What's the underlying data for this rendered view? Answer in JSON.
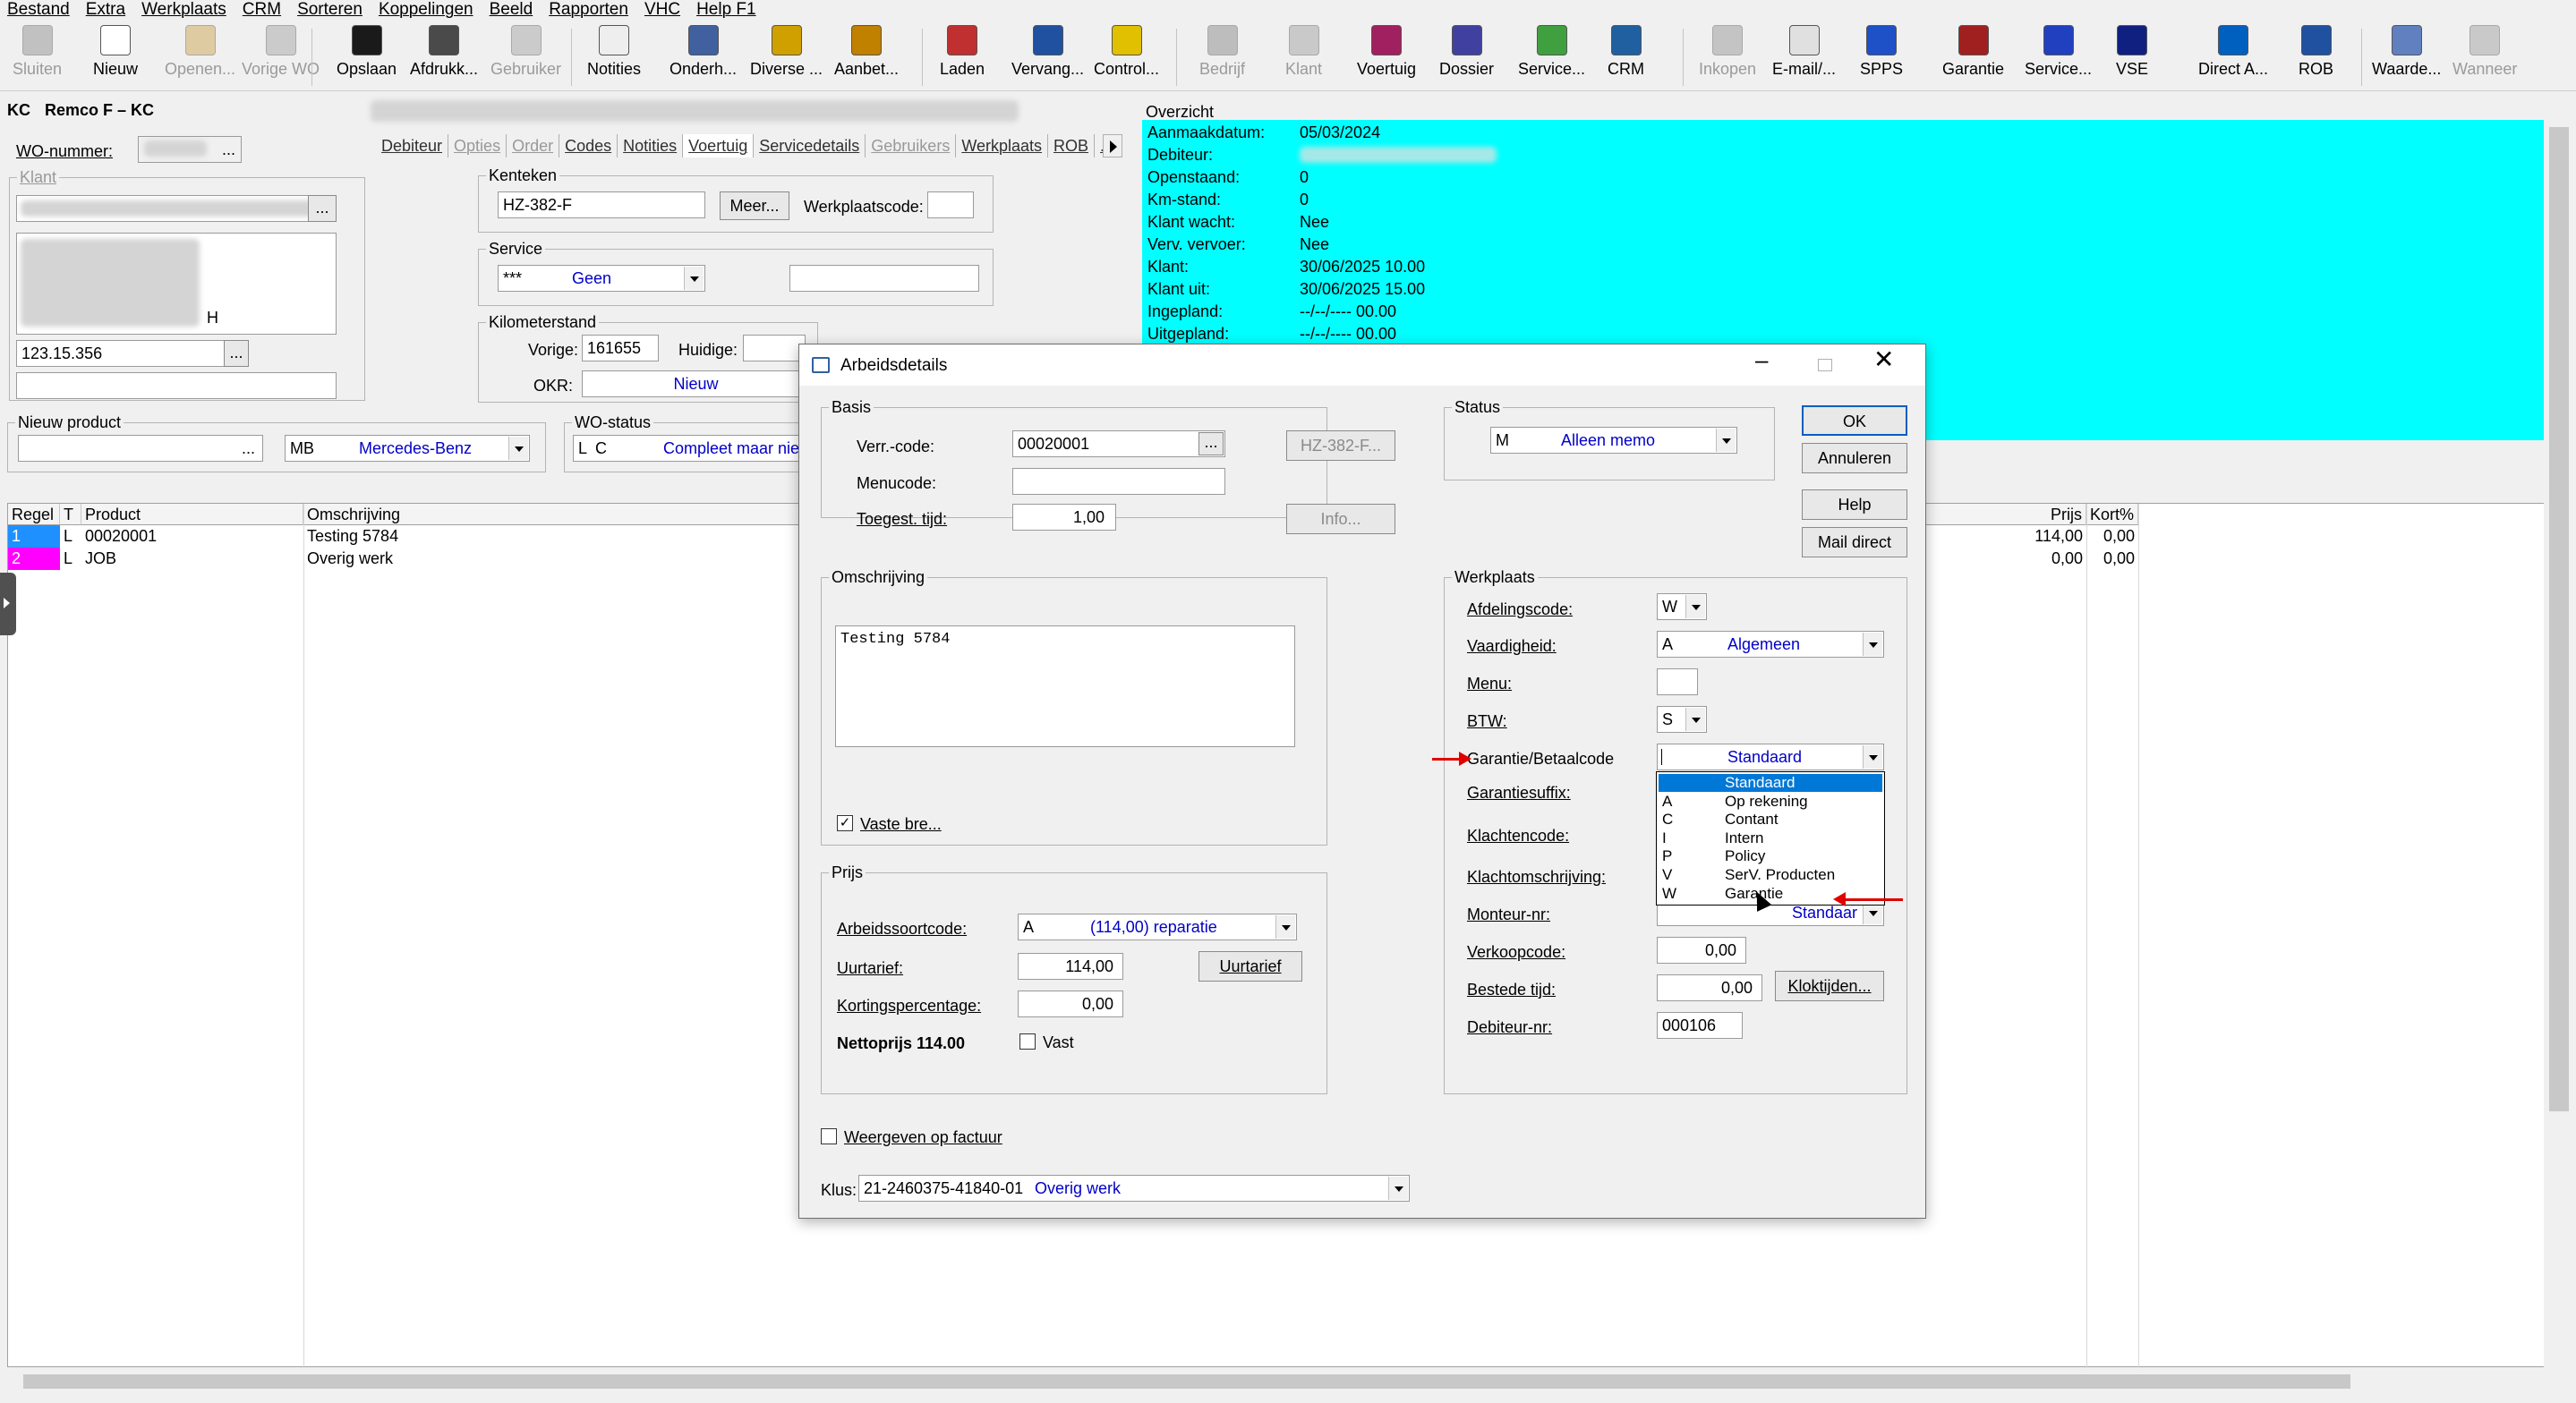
{
  "menu": [
    "Bestand",
    "Extra",
    "Werkplaats",
    "CRM",
    "Sorteren",
    "Koppelingen",
    "Beeld",
    "Rapporten",
    "VHC",
    "Help F1"
  ],
  "toolbar": [
    {
      "label": "Sluiten",
      "icon": "close-door-icon",
      "enabled": false
    },
    {
      "label": "Nieuw",
      "icon": "new-document-icon",
      "enabled": true
    },
    {
      "label": "Openen...",
      "icon": "open-folder-icon",
      "enabled": false
    },
    {
      "label": "Vorige WO",
      "icon": "redo-icon",
      "enabled": false
    },
    {
      "label": "Opslaan",
      "icon": "save-icon",
      "enabled": true
    },
    {
      "label": "Afdrukk...",
      "icon": "printer-icon",
      "enabled": true
    },
    {
      "label": "Gebruiker",
      "icon": "user-icon",
      "enabled": false
    },
    {
      "label": "Notities",
      "icon": "notes-icon",
      "enabled": true
    },
    {
      "label": "Onderh...",
      "icon": "maintenance-icon",
      "enabled": true
    },
    {
      "label": "Diverse ...",
      "icon": "tag-icon",
      "enabled": true
    },
    {
      "label": "Aanbet...",
      "icon": "quote-icon",
      "enabled": true
    },
    {
      "label": "Laden",
      "icon": "load-icon",
      "enabled": true
    },
    {
      "label": "Vervang...",
      "icon": "replace-icon",
      "enabled": true
    },
    {
      "label": "Control...",
      "icon": "keys-icon",
      "enabled": true
    },
    {
      "label": "Bedrijf",
      "icon": "building-icon",
      "enabled": false
    },
    {
      "label": "Klant",
      "icon": "customer-icon",
      "enabled": false
    },
    {
      "label": "Voertuig",
      "icon": "vehicle-icon",
      "enabled": true
    },
    {
      "label": "Dossier",
      "icon": "dossier-icon",
      "enabled": true
    },
    {
      "label": "Service...",
      "icon": "service-icon",
      "enabled": true
    },
    {
      "label": "CRM",
      "icon": "crm-book-icon",
      "enabled": true
    },
    {
      "label": "Inkopen",
      "icon": "purchase-icon",
      "enabled": false
    },
    {
      "label": "E-mail/...",
      "icon": "email-icon",
      "enabled": true
    },
    {
      "label": "SPPS",
      "icon": "spps-icon",
      "enabled": true
    },
    {
      "label": "Garantie",
      "icon": "warranty-icon",
      "enabled": true
    },
    {
      "label": "Service...",
      "icon": "kdm-service-icon",
      "enabled": true
    },
    {
      "label": "VSE",
      "icon": "vse-icon",
      "enabled": true
    },
    {
      "label": "Direct A...",
      "icon": "direct-icon",
      "enabled": true
    },
    {
      "label": "ROB",
      "icon": "rob-icon",
      "enabled": true
    },
    {
      "label": "Waarde...",
      "icon": "value-icon",
      "enabled": true
    },
    {
      "label": "Wanneer",
      "icon": "calendar-icon",
      "enabled": false
    }
  ],
  "header": {
    "kc": "KC",
    "user": "Remco F – KC"
  },
  "wo": {
    "label": "WO-nummer:",
    "klant_label": "Klant",
    "id_value": "123.15.356",
    "h": "H"
  },
  "tabs": [
    "Debiteur",
    "Opties",
    "Order",
    "Codes",
    "Notities",
    "Voertuig",
    "Servicedetails",
    "Gebruikers",
    "Werkplaats",
    "ROB",
    "..."
  ],
  "kenteken": {
    "label": "Kenteken",
    "value": "HZ-382-F",
    "meer": "Meer...",
    "werkplaats_label": "Werkplaatscode:"
  },
  "service": {
    "label": "Service",
    "code": "***",
    "value": "Geen"
  },
  "km": {
    "label": "Kilometerstand",
    "vorige_label": "Vorige:",
    "vorige": "161655",
    "huidige_label": "Huidige:",
    "okr_label": "OKR:",
    "okr": "Nieuw"
  },
  "nieuw_product": {
    "label": "Nieuw product",
    "brand_code": "MB",
    "brand": "Mercedes-Benz"
  },
  "wo_status": {
    "label": "WO-status",
    "code": "L",
    "value": "C",
    "text": "Compleet maar niet g"
  },
  "overzicht": {
    "title": "Overzicht",
    "rows": [
      {
        "k": "Aanmaakdatum:",
        "v": "05/03/2024"
      },
      {
        "k": "Debiteur:",
        "v": ""
      },
      {
        "k": "Openstaand:",
        "v": "0"
      },
      {
        "k": "Km-stand:",
        "v": "0"
      },
      {
        "k": "Klant wacht:",
        "v": "Nee"
      },
      {
        "k": "Verv. vervoer:",
        "v": "Nee"
      },
      {
        "k": "Klant:",
        "v": "30/06/2025 10.00"
      },
      {
        "k": "Klant uit:",
        "v": "30/06/2025 15.00"
      },
      {
        "k": "Ingepland:",
        "v": "--/--/---- 00.00"
      },
      {
        "k": "Uitgepland:",
        "v": "--/--/---- 00.00"
      }
    ]
  },
  "grid": {
    "headers": [
      "Regel",
      "T",
      "Product",
      "Omschrijving",
      "Prijs",
      "Kort%"
    ],
    "rows": [
      {
        "regel": "1",
        "t": "L",
        "product": "00020001",
        "omschrijving": "Testing 5784",
        "prijs": "114,00",
        "kort": "0,00",
        "color": "#1e90ff"
      },
      {
        "regel": "2",
        "t": "L",
        "product": "JOB",
        "omschrijving": "Overig werk",
        "prijs": "0,00",
        "kort": "0,00",
        "color": "#ff00ff"
      }
    ]
  },
  "dialog": {
    "title": "Arbeidsdetails",
    "basis": {
      "title": "Basis",
      "verr_label": "Verr.-code:",
      "verr": "00020001",
      "plate_btn": "HZ-382-F...",
      "menucode_label": "Menucode:",
      "menucode": "",
      "toegest_label": "Toegest. tijd:",
      "toegest": "1,00",
      "info_btn": "Info..."
    },
    "omschrijving": {
      "title": "Omschrijving",
      "text": "Testing 5784",
      "vaste_label": "Vaste bre..."
    },
    "prijs": {
      "title": "Prijs",
      "arbeid_label": "Arbeidssoortcode:",
      "arbeid_code": "A",
      "arbeid_value": "(114,00) reparatie",
      "uurtarief_label": "Uurtarief:",
      "uurtarief": "114,00",
      "uurtarief_btn": "Uurtarief",
      "korting_label": "Kortingspercentage:",
      "korting": "0,00",
      "netto": "Nettoprijs 114.00",
      "vast_label": "Vast"
    },
    "weergeven_label": "Weergeven op factuur",
    "klus_label": "Klus:",
    "klus_code": "21-2460375-41840-01",
    "klus_value": "Overig werk",
    "status": {
      "title": "Status",
      "code": "M",
      "value": "Alleen memo"
    },
    "buttons": {
      "ok": "OK",
      "annuleren": "Annuleren",
      "help": "Help",
      "mail": "Mail direct"
    },
    "werkplaats": {
      "title": "Werkplaats",
      "afdeling_label": "Afdelingscode:",
      "afdeling": "W",
      "vaardigheid_label": "Vaardigheid:",
      "vaardigheid_code": "A",
      "vaardigheid": "Algemeen",
      "menu_label": "Menu:",
      "btw_label": "BTW:",
      "btw": "S",
      "garantie_label": "Garantie/Betaalcode",
      "garantie": "Standaard",
      "suffix_label": "Garantiesuffix:",
      "klachtencode_label": "Klachtencode:",
      "klachtomschrijving_label": "Klachtomschrijving:",
      "monteur_label": "Monteur-nr:",
      "monteur": "Standaar",
      "verkoopcode_label": "Verkoopcode:",
      "verkoopcode": "0,00",
      "bestede_label": "Bestede tijd:",
      "bestede": "0,00",
      "klok_btn": "Kloktijden...",
      "debiteur_label": "Debiteur-nr:",
      "debiteur": "000106"
    },
    "dropdown": [
      {
        "code": "",
        "text": "Standaard"
      },
      {
        "code": "A",
        "text": "Op rekening"
      },
      {
        "code": "C",
        "text": "Contant"
      },
      {
        "code": "I",
        "text": "Intern"
      },
      {
        "code": "P",
        "text": "Policy"
      },
      {
        "code": "V",
        "text": "SerV. Producten"
      },
      {
        "code": "W",
        "text": "Garantie"
      }
    ]
  },
  "annotation_color": "#e00000"
}
